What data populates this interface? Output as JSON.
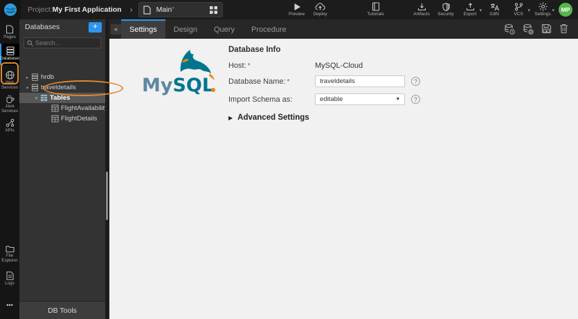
{
  "glyphs": {
    "chevron": "›",
    "collapse": "«",
    "caret_down": "▾",
    "select_caret": "▼",
    "tree_open": "▾",
    "tree_closed": "▸",
    "section_closed": "▶",
    "plus": "+",
    "help": "?",
    "required": "*",
    "dirty": "*",
    "more": "•••"
  },
  "topbar": {
    "project_label": "Project:",
    "project_name": "My First Application",
    "main_tab": "Main",
    "actions": {
      "preview": "Preview",
      "deploy": "Deploy",
      "tutorials": "Tutorials",
      "artifacts": "Artifacts",
      "security": "Security",
      "export": "Export",
      "i18n": "I18N",
      "vcs": "VCS",
      "settings": "Settings"
    },
    "avatar": "MP"
  },
  "sidebar": {
    "pages": "Pages",
    "databases": "Databases",
    "web_services": "Web Services",
    "java_services": "Java Services",
    "apis": "APIs",
    "file_explorer": "File Explorer",
    "logs": "Logs"
  },
  "panel": {
    "title": "Databases",
    "search_placeholder": "Search...",
    "tree": [
      {
        "label": "hrdb"
      },
      {
        "label": "traveldetails"
      },
      {
        "label": "Tables"
      },
      {
        "label": "FlightAvailability"
      },
      {
        "label": "FlightDetails"
      }
    ],
    "footer": "DB Tools"
  },
  "tabs": {
    "settings": "Settings",
    "design": "Design",
    "query": "Query",
    "procedure": "Procedure"
  },
  "form": {
    "heading": "Database Info",
    "host_label": "Host:",
    "host_value": "MySQL-Cloud",
    "dbname_label": "Database Name:",
    "dbname_value": "traveldetails",
    "schema_label": "Import Schema as:",
    "schema_value": "editable",
    "advanced": "Advanced Settings"
  },
  "colors": {
    "accent_blue": "#2e95ef",
    "annotation_orange": "#e2882f",
    "avatar_green": "#56b64c",
    "required_red": "#cc4437",
    "mysql_blue": "#00758f",
    "mysql_steel": "#5d87a1",
    "mysql_orange": "#e8890c"
  }
}
